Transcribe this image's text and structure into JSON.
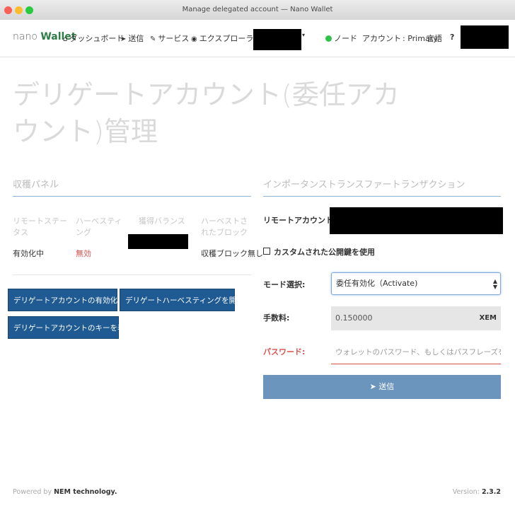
{
  "window": {
    "title": "Manage delegated account — Nano Wallet"
  },
  "navbar": {
    "brand_prefix": "nano",
    "brand_name": "Wallet",
    "dashboard": "ダッシュボード",
    "send": "送信",
    "services": "サービス",
    "explorer": "エクスプローラー",
    "node": "ノード",
    "account_label": "アカウント",
    "account_value": ": Primary",
    "language": "言語",
    "help": "?",
    "node_status_color": "#2fc24a"
  },
  "page": {
    "title": "デリゲートアカウント(委任アカウント)管理"
  },
  "harvest_panel": {
    "heading": "収穫パネル",
    "headers": [
      "リモートステータス",
      "ハーベスティング",
      "獲得バランス",
      "ハーベストされたブロック"
    ],
    "values": {
      "remote_status": "有効化中",
      "harvesting": "無効",
      "harvested_blocks": "収穫ブロック無し"
    },
    "buttons": {
      "toggle_delegated": "デリゲートアカウントの有効化 / 無効化",
      "toggle_harvesting": "デリゲートハーベスティングを開始 / 停止",
      "show_keys": "デリゲートアカウントのキーを表示する"
    }
  },
  "importance_transfer": {
    "heading": "インポータンストランスファートランザクション",
    "remote_account_label": "リモートアカウント:",
    "custom_key_label": "カスタムされた公開鍵を使用",
    "mode_label": "モード選択:",
    "mode_value": "委任有効化（Activate)",
    "fee_label": "手数料:",
    "fee_value": "0.150000",
    "fee_unit": "XEM",
    "password_label": "パスワード:",
    "password_placeholder": "ウォレットのパスワード、もしくはパスフレーズを入力...",
    "send_label": "送信"
  },
  "footer": {
    "powered_prefix": "Powered by",
    "powered_by": "NEM technology.",
    "version_label": "Version:",
    "version": "2.3.2"
  }
}
